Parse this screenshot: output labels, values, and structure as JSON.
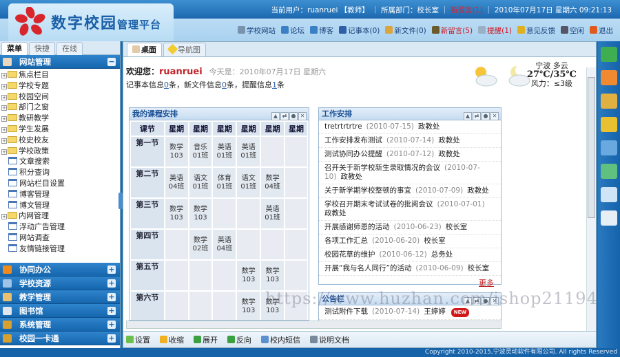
{
  "header": {
    "logo_title": "数字校园",
    "logo_subtitle": "管理平台",
    "user_label": "当前用户：ruanruei 【教师】",
    "dept_label": "所属部门：校长室",
    "alert": "新留言(1)",
    "datetime": "2010年07月17日 星期六 09:21:13",
    "links": [
      {
        "label": "学校网站",
        "color": "#7a93ad"
      },
      {
        "label": "论坛",
        "color": "#3b7fc4"
      },
      {
        "label": "博客",
        "color": "#3b7fc4"
      },
      {
        "label": "记事本(0)",
        "color": "#2f5fa6"
      },
      {
        "label": "新文件(0)",
        "color": "#d9a53c"
      },
      {
        "label": "新留言(5)",
        "color": "#6b5a2a",
        "red": true
      },
      {
        "label": "提醒(1)",
        "color": "#9ab0c4",
        "red": true
      },
      {
        "label": "意见反馈",
        "color": "#e0b020"
      },
      {
        "label": "空闲",
        "color": "#556"
      },
      {
        "label": "退出",
        "color": "#e05a20"
      }
    ]
  },
  "sidebar": {
    "tabs": [
      "菜单",
      "快捷",
      "在线"
    ],
    "open_section": "网站管理",
    "tree": [
      {
        "label": "焦点栏目",
        "t": "f"
      },
      {
        "label": "学校专题",
        "t": "f"
      },
      {
        "label": "校园空间",
        "t": "f"
      },
      {
        "label": "部门之窗",
        "t": "f"
      },
      {
        "label": "教研教学",
        "t": "f"
      },
      {
        "label": "学生发展",
        "t": "f"
      },
      {
        "label": "校史校友",
        "t": "f"
      },
      {
        "label": "学校政策",
        "t": "f"
      },
      {
        "label": "文章搜索",
        "t": "p"
      },
      {
        "label": "积分查询",
        "t": "p"
      },
      {
        "label": "网站栏目设置",
        "t": "p"
      },
      {
        "label": "博客管理",
        "t": "p"
      },
      {
        "label": "博文管理",
        "t": "p"
      },
      {
        "label": "内网管理",
        "t": "f"
      },
      {
        "label": "浮动广告管理",
        "t": "p"
      },
      {
        "label": "网站调查",
        "t": "p"
      },
      {
        "label": "友情链接管理",
        "t": "p"
      }
    ],
    "sections": [
      {
        "label": "协同办公",
        "color": "#f08a1c"
      },
      {
        "label": "学校资源",
        "color": "#9fc3e6"
      },
      {
        "label": "教学管理",
        "color": "#e8c070"
      },
      {
        "label": "图书馆",
        "color": "#e0e6ee"
      },
      {
        "label": "系统管理",
        "color": "#d8a030"
      },
      {
        "label": "校园一卡通",
        "color": "#d8a030"
      }
    ]
  },
  "main": {
    "tabs": [
      "桌面",
      "导航图"
    ],
    "welcome": "欢迎您：",
    "username": "ruanruei",
    "today": "今天是：2010年07月17日 星期六",
    "info": {
      "p1": "记事本信息",
      "n1": "0",
      "p2": "条，新文件信息",
      "n2": "0",
      "p3": "条，提醒信息",
      "n3": "1",
      "p4": "条"
    },
    "weather": {
      "city": "宁波 多云",
      "temp": "27℃/35℃",
      "wind": "风力：≤3级"
    },
    "course": {
      "title": "我的课程安排",
      "headers": [
        "课节",
        "星期",
        "星期",
        "星期",
        "星期",
        "星期",
        "星期"
      ],
      "rows": [
        {
          "label": "第一节",
          "cells": [
            [
              "数学",
              "103"
            ],
            [
              "音乐",
              "01班"
            ],
            [
              "英语",
              "01班"
            ],
            [
              "英语",
              "01班"
            ],
            null,
            null
          ]
        },
        {
          "label": "第二节",
          "cells": [
            [
              "英语",
              "04班"
            ],
            [
              "语文",
              "01班"
            ],
            [
              "体育",
              "01班"
            ],
            [
              "语文",
              "01班"
            ],
            [
              "数学",
              "04班"
            ],
            null
          ]
        },
        {
          "label": "第三节",
          "cells": [
            [
              "数学",
              "103"
            ],
            [
              "数学",
              "103"
            ],
            null,
            null,
            [
              "英语",
              "01班"
            ],
            null
          ]
        },
        {
          "label": "第四节",
          "cells": [
            null,
            [
              "数学",
              "02班"
            ],
            [
              "英语",
              "04班"
            ],
            null,
            null,
            null
          ]
        },
        {
          "label": "第五节",
          "cells": [
            null,
            null,
            null,
            [
              "数学",
              "103"
            ],
            [
              "数学",
              "103"
            ],
            null
          ]
        },
        {
          "label": "第六节",
          "cells": [
            null,
            null,
            null,
            [
              "数学",
              "103"
            ],
            [
              "数学",
              "103"
            ],
            null
          ]
        }
      ]
    },
    "work": {
      "title": "工作安排",
      "items": [
        {
          "t": "tretrtrtrtre",
          "d": "(2010-07-15)",
          "o": "政教处"
        },
        {
          "t": "工作安排发布测试",
          "d": "(2010-07-14)",
          "o": "政教处"
        },
        {
          "t": "测试协同办公提醒",
          "d": "(2010-07-12)",
          "o": "政教处"
        },
        {
          "t": "召开关于新学校新生录取情况的会议",
          "d": "(2010-07-10)",
          "o": "政教处"
        },
        {
          "t": "关于新学期学校整顿的事宜",
          "d": "(2010-07-09)",
          "o": "政教处"
        },
        {
          "t": "学校召开期末考试试卷的批阅会议",
          "d": "(2010-07-01)",
          "o": "政教处"
        },
        {
          "t": "开展感谢师恩的活动",
          "d": "(2010-06-23)",
          "o": "校长室"
        },
        {
          "t": "各项工作汇总",
          "d": "(2010-06-20)",
          "o": "校长室"
        },
        {
          "t": "校园花草的维护",
          "d": "(2010-06-12)",
          "o": "总务处"
        },
        {
          "t": "开展“我与名人同行”的活动",
          "d": "(2010-06-09)",
          "o": "校长室"
        }
      ],
      "more": "更多"
    },
    "notice": {
      "title": "公告栏",
      "items": [
        {
          "t": "测试附件下载",
          "d": "(2010-07-14)",
          "o": "王婷婷",
          "badge": "NEW"
        }
      ]
    },
    "toolbar": [
      {
        "label": "设置",
        "color": "#6cbf4a"
      },
      {
        "label": "收缩",
        "color": "#f0b020"
      },
      {
        "label": "展开",
        "color": "#3aa040"
      },
      {
        "label": "反向",
        "color": "#3aa040"
      },
      {
        "label": "校内短信",
        "color": "#5a8fd0"
      },
      {
        "label": "说明文档",
        "color": "#7a8a9a"
      }
    ]
  },
  "watermark": "https://www.huzhan.com/ishop21194",
  "right_toolbar": [
    "#3fae50",
    "#f08a30",
    "#e0b040",
    "#e8c030",
    "#6aa8e0",
    "#60c080",
    "#cfe4f6",
    "#e6eef6"
  ],
  "footer": "Copyright 2010-2015,宁波灵动软件有限公司. All rights Reserved"
}
